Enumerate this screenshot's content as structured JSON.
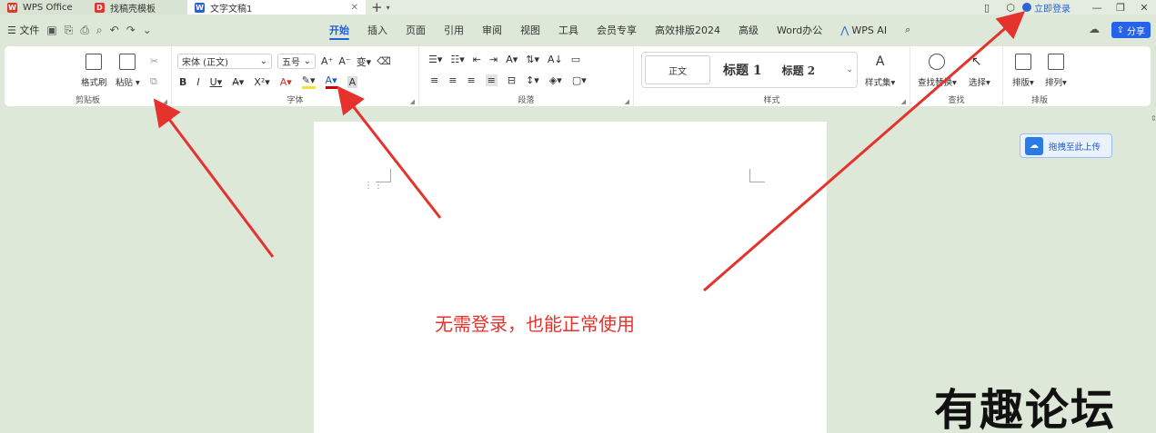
{
  "tabs": [
    {
      "label": "WPS Office"
    },
    {
      "label": "找稿壳模板"
    },
    {
      "label": "文字文稿1"
    }
  ],
  "window": {
    "login": "立即登录",
    "share": "分享"
  },
  "menu": {
    "file": "文件",
    "tabs": [
      "开始",
      "插入",
      "页面",
      "引用",
      "审阅",
      "视图",
      "工具",
      "会员专享",
      "高效排版2024",
      "高级",
      "Word办公",
      "WPS AI"
    ]
  },
  "ribbon": {
    "clipboard": {
      "label": "剪贴板",
      "format_painter": "格式刷",
      "paste": "粘贴"
    },
    "font": {
      "label": "字体",
      "font_name": "宋体 (正文)",
      "font_size": "五号",
      "bold": "B",
      "italic": "I",
      "underline": "U",
      "sample": "A"
    },
    "paragraph": {
      "label": "段落"
    },
    "styles": {
      "label": "样式",
      "normal": "正文",
      "h1": "标题 1",
      "h2": "标题 2",
      "style_set": "样式集"
    },
    "find": {
      "label": "查找",
      "find_replace": "查找替换",
      "select": "选择"
    },
    "layout": {
      "label": "排版",
      "arrange": "排版",
      "order": "排列"
    }
  },
  "page": {
    "annotation": "无需登录，也能正常使用"
  },
  "upload": {
    "label": "拖拽至此上传"
  },
  "watermark": "有趣论坛",
  "colors": {
    "accent": "#1f5fe0",
    "arrow": "#e5322d"
  }
}
